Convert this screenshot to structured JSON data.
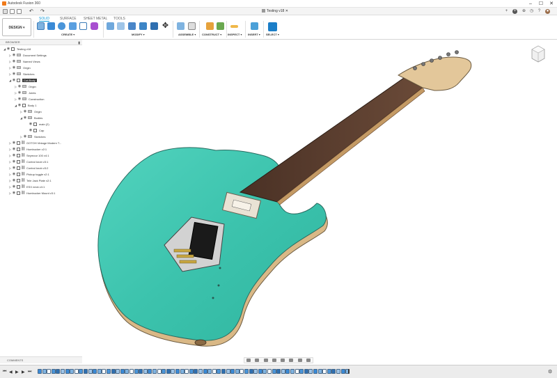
{
  "app": {
    "title": "Autodesk Fusion 360",
    "doc_tab": "Testing v18"
  },
  "ribbon": {
    "workspace": "DESIGN ▾",
    "tabs": [
      "SOLID",
      "SURFACE",
      "SHEET METAL",
      "TOOLS"
    ],
    "active_tab": "SOLID",
    "groups": [
      "CREATE ▾",
      "MODIFY ▾",
      "ASSEMBLE ▾",
      "CONSTRUCT ▾",
      "INSPECT ▾",
      "INSERT ▾",
      "SELECT ▾"
    ]
  },
  "browser": {
    "title": "BROWSER",
    "items": [
      {
        "label": "Testing v18",
        "depth": 0,
        "arrow": "◢",
        "type": "doc"
      },
      {
        "label": "Document Settings",
        "depth": 1,
        "arrow": "▷",
        "type": "fold"
      },
      {
        "label": "Named Views",
        "depth": 1,
        "arrow": "▷",
        "type": "fold"
      },
      {
        "label": "Origin",
        "depth": 1,
        "arrow": "▷",
        "type": "fold"
      },
      {
        "label": "Sketches",
        "depth": 1,
        "arrow": "▷",
        "type": "fold"
      },
      {
        "label": "Cut-Body",
        "depth": 1,
        "arrow": "◢",
        "type": "comp",
        "selected": true
      },
      {
        "label": "Origin",
        "depth": 2,
        "arrow": "▷",
        "type": "fold"
      },
      {
        "label": "Joints",
        "depth": 2,
        "arrow": "▷",
        "type": "fold"
      },
      {
        "label": "Construction",
        "depth": 2,
        "arrow": "▷",
        "type": "fold"
      },
      {
        "label": "Body 1",
        "depth": 2,
        "arrow": "◢",
        "type": "comp"
      },
      {
        "label": "Origin",
        "depth": 3,
        "arrow": "▷",
        "type": "fold"
      },
      {
        "label": "Bodies",
        "depth": 3,
        "arrow": "◢",
        "type": "fold"
      },
      {
        "label": "main (2)",
        "depth": 4,
        "arrow": "",
        "type": "comp"
      },
      {
        "label": "Cap",
        "depth": 4,
        "arrow": "",
        "type": "comp"
      },
      {
        "label": "Sketches",
        "depth": 3,
        "arrow": "▷",
        "type": "fold"
      },
      {
        "label": "GOTOH Vintage Modern T...",
        "depth": 1,
        "arrow": "▷",
        "type": "link"
      },
      {
        "label": "Humbucker v2:1",
        "depth": 1,
        "arrow": "▷",
        "type": "link"
      },
      {
        "label": "Seymour 100 v4:1",
        "depth": 1,
        "arrow": "▷",
        "type": "link"
      },
      {
        "label": "Control knob v3:1",
        "depth": 1,
        "arrow": "▷",
        "type": "link"
      },
      {
        "label": "Control knob v3:2",
        "depth": 1,
        "arrow": "▷",
        "type": "link"
      },
      {
        "label": "Pickup toggle v2:1",
        "depth": 1,
        "arrow": "▷",
        "type": "link"
      },
      {
        "label": "Tele Jack Plate v2:1",
        "depth": 1,
        "arrow": "▷",
        "type": "link"
      },
      {
        "label": "ESX neck v4:1",
        "depth": 1,
        "arrow": "▷",
        "type": "link"
      },
      {
        "label": "Humbucker Mount v3:1",
        "depth": 1,
        "arrow": "▷",
        "type": "link"
      }
    ]
  },
  "comments": {
    "title": "COMMENTS"
  },
  "colors": {
    "body": "#3fc6b0",
    "neck": "#5a3d2e",
    "maple": "#e3c79a",
    "accent": "#0696d7"
  }
}
